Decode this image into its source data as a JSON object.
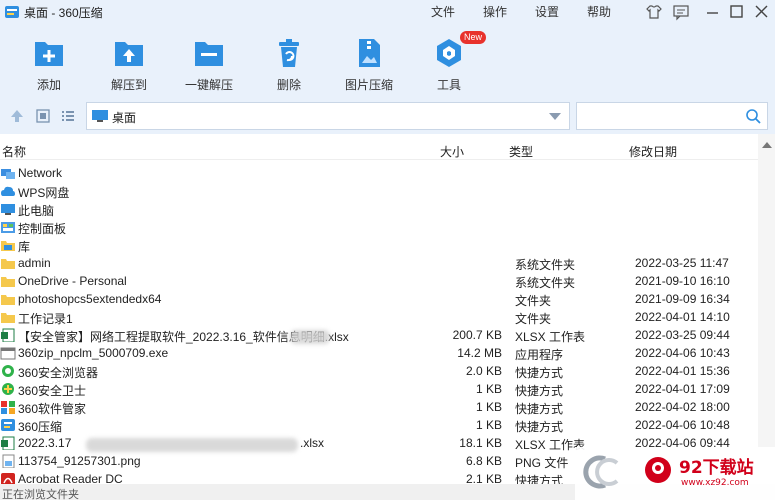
{
  "window": {
    "title": "桌面 - 360压缩",
    "menu": [
      "文件",
      "操作",
      "设置",
      "帮助"
    ]
  },
  "toolbar": {
    "items": [
      {
        "label": "添加",
        "icon": "add-archive-icon"
      },
      {
        "label": "解压到",
        "icon": "extract-to-icon"
      },
      {
        "label": "一键解压",
        "icon": "one-click-extract-icon"
      },
      {
        "label": "删除",
        "icon": "delete-icon"
      },
      {
        "label": "图片压缩",
        "icon": "image-compress-icon"
      },
      {
        "label": "工具",
        "icon": "tools-icon",
        "badge": "New"
      }
    ]
  },
  "address": {
    "path": "桌面",
    "search_placeholder": ""
  },
  "columns": {
    "name": "名称",
    "size": "大小",
    "type": "类型",
    "modified": "修改日期"
  },
  "rows": [
    {
      "name": "Network",
      "size": "",
      "type": "",
      "modified": "",
      "icon": "network-icon"
    },
    {
      "name": "WPS网盘",
      "size": "",
      "type": "",
      "modified": "",
      "icon": "cloud-drive-icon"
    },
    {
      "name": "此电脑",
      "size": "",
      "type": "",
      "modified": "",
      "icon": "computer-icon"
    },
    {
      "name": "控制面板",
      "size": "",
      "type": "",
      "modified": "",
      "icon": "control-panel-icon"
    },
    {
      "name": "库",
      "size": "",
      "type": "",
      "modified": "",
      "icon": "library-icon"
    },
    {
      "name": "admin",
      "size": "",
      "type": "系统文件夹",
      "modified": "2022-03-25 11:47",
      "icon": "folder-icon"
    },
    {
      "name": "OneDrive - Personal",
      "size": "",
      "type": "系统文件夹",
      "modified": "2021-09-10 16:10",
      "icon": "folder-icon"
    },
    {
      "name": "photoshopcs5extendedx64",
      "size": "",
      "type": "文件夹",
      "modified": "2021-09-09 16:34",
      "icon": "folder-icon"
    },
    {
      "name": "工作记录1",
      "size": "",
      "type": "文件夹",
      "modified": "2022-04-01 14:10",
      "icon": "folder-icon"
    },
    {
      "name": "【安全管家】网络工程提取软件_2022.3.16_软件信息明细.xlsx",
      "size": "200.7 KB",
      "type": "XLSX 工作表",
      "modified": "2022-03-25 09:44",
      "icon": "excel-file-icon"
    },
    {
      "name": "360zip_npclm_5000709.exe",
      "size": "14.2 MB",
      "type": "应用程序",
      "modified": "2022-04-06 10:43",
      "icon": "exe-file-icon"
    },
    {
      "name": "360安全浏览器",
      "size": "2.0 KB",
      "type": "快捷方式",
      "modified": "2022-04-01 15:36",
      "icon": "browser-icon"
    },
    {
      "name": "360安全卫士",
      "size": "1 KB",
      "type": "快捷方式",
      "modified": "2022-04-01 17:09",
      "icon": "guard-icon"
    },
    {
      "name": "360软件管家",
      "size": "1 KB",
      "type": "快捷方式",
      "modified": "2022-04-02 18:00",
      "icon": "software-manager-icon"
    },
    {
      "name": "360压缩",
      "size": "1 KB",
      "type": "快捷方式",
      "modified": "2022-04-06 10:48",
      "icon": "zip-app-icon"
    },
    {
      "name": "2022.3.17",
      "name_suffix": ".xlsx",
      "size": "18.1 KB",
      "type": "XLSX 工作表",
      "modified": "2022-04-06 09:44",
      "icon": "excel-file-icon"
    },
    {
      "name": "113754_91257301.png",
      "size": "6.8 KB",
      "type": "PNG 文件",
      "modified": "",
      "icon": "png-file-icon"
    },
    {
      "name": "Acrobat Reader DC",
      "size": "2.1 KB",
      "type": "快捷方式",
      "modified": "",
      "icon": "pdf-reader-icon"
    }
  ],
  "status": "正在浏览文件夹",
  "watermark": {
    "title": "92下载站",
    "url": "www.xz92.com"
  },
  "colors": {
    "accent": "#2f8fe0",
    "topband": "#e9f1fb",
    "folder": "#f5c84c"
  }
}
